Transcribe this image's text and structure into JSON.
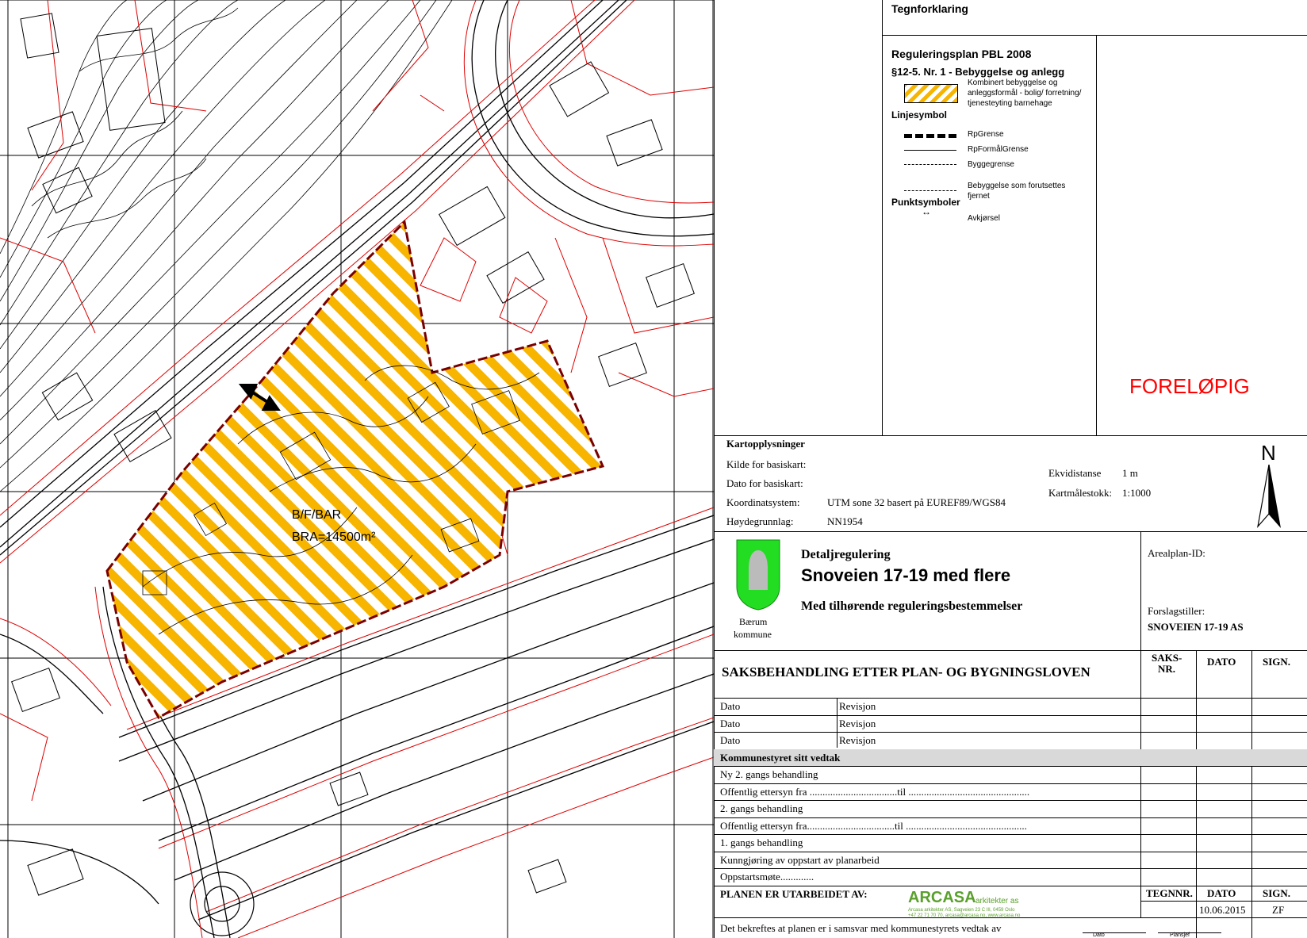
{
  "map": {
    "area_label": "B/F/BAR",
    "area_bra": "BRA=14500m²"
  },
  "legend": {
    "title": "Tegnforklaring",
    "plan_title": "Reguleringsplan PBL 2008",
    "section": "§12-5. Nr. 1 - Bebyggelse og anlegg",
    "zone_desc": [
      "Kombinert bebyggelse og",
      "anleggsformål - bolig/ forretning/",
      "tjenesteyting barnehage"
    ],
    "line_heading": "Linjesymbol",
    "lines": [
      "RpGrense",
      "RpFormålGrense",
      "Byggegrense",
      "Bebyggelse som forutsettes",
      "fjernet"
    ],
    "point_heading": "Punktsymboler",
    "points": [
      "Avkjørsel"
    ],
    "status_stamp": "FORELØPIG",
    "stamp_color": "#ff0000"
  },
  "kart": {
    "heading": "Kartopplysninger",
    "kilde_label": "Kilde for basiskart:",
    "dato_label": "Dato for basiskart:",
    "koord_label": "Koordinatsystem:",
    "koord_value": "UTM sone 32 basert på EUREF89/WGS84",
    "hoyde_label": "Høydegrunnlag:",
    "hoyde_value": "NN1954",
    "ekvi_label": "Ekvidistanse",
    "ekvi_value": "1 m",
    "scale_label": "Kartmålestokk:",
    "scale_value": "1:1000",
    "north": "N"
  },
  "title_block": {
    "type": "Detaljregulering",
    "name": "Snoveien 17-19 med flere",
    "subtitle": "Med tilhørende reguleringsbestemmelser",
    "municipality": [
      "Bærum",
      "kommune"
    ],
    "arealplan_label": "Arealplan-ID:",
    "forslagstiller_label": "Forslagstiller:",
    "forslagstiller_value": "SNOVEIEN 17-19 AS",
    "brand_color": "#22dd22"
  },
  "saksbehandling": {
    "heading": "SAKSBEHANDLING ETTER PLAN- OG BYGNINGSLOVEN",
    "col_saksnr": [
      "SAKS-",
      "NR."
    ],
    "col_dato": "DATO",
    "col_sign": "SIGN.",
    "rows": [
      {
        "a": "Dato",
        "b": "Revisjon"
      },
      {
        "a": "Dato",
        "b": "Revisjon"
      },
      {
        "a": "Dato",
        "b": "Revisjon"
      },
      {
        "a": "Kommunestyret sitt vedtak",
        "b": "",
        "shaded": true
      },
      {
        "a": "Ny 2. gangs behandling",
        "b": ""
      },
      {
        "a": "Offentlig ettersyn fra ..................................til ...............................................",
        "b": ""
      },
      {
        "a": "2. gangs behandling",
        "b": ""
      },
      {
        "a": "Offentlig ettersyn fra..................................til ...............................................",
        "b": ""
      },
      {
        "a": "1. gangs behandling",
        "b": ""
      },
      {
        "a": "Kunngjøring av oppstart av planarbeid",
        "b": ""
      },
      {
        "a": "Oppstartsmøte.............",
        "b": ""
      }
    ]
  },
  "footer": {
    "prepared_by": "PLANEN ER UTARBEIDET AV:",
    "company": "ARCASA",
    "company_suffix": "arkitekter as",
    "company_line1": "Arcasa arkitekter AS, Sagveien 23 C III, 0459 Oslo",
    "company_line2": "+47 22 71 70 70, arcasa@arcasa.no, www.arcasa.no",
    "company_color": "#5aa02c",
    "col_tegnnr": "TEGNNR.",
    "col_dato": "DATO",
    "col_sign": "SIGN.",
    "date_value": "10.06.2015",
    "sign_value": "ZF",
    "certify": "Det bekreftes at planen er i samsvar med kommunestyrets vedtak av",
    "sig_labels": [
      "Dato",
      "Plansjef"
    ]
  }
}
